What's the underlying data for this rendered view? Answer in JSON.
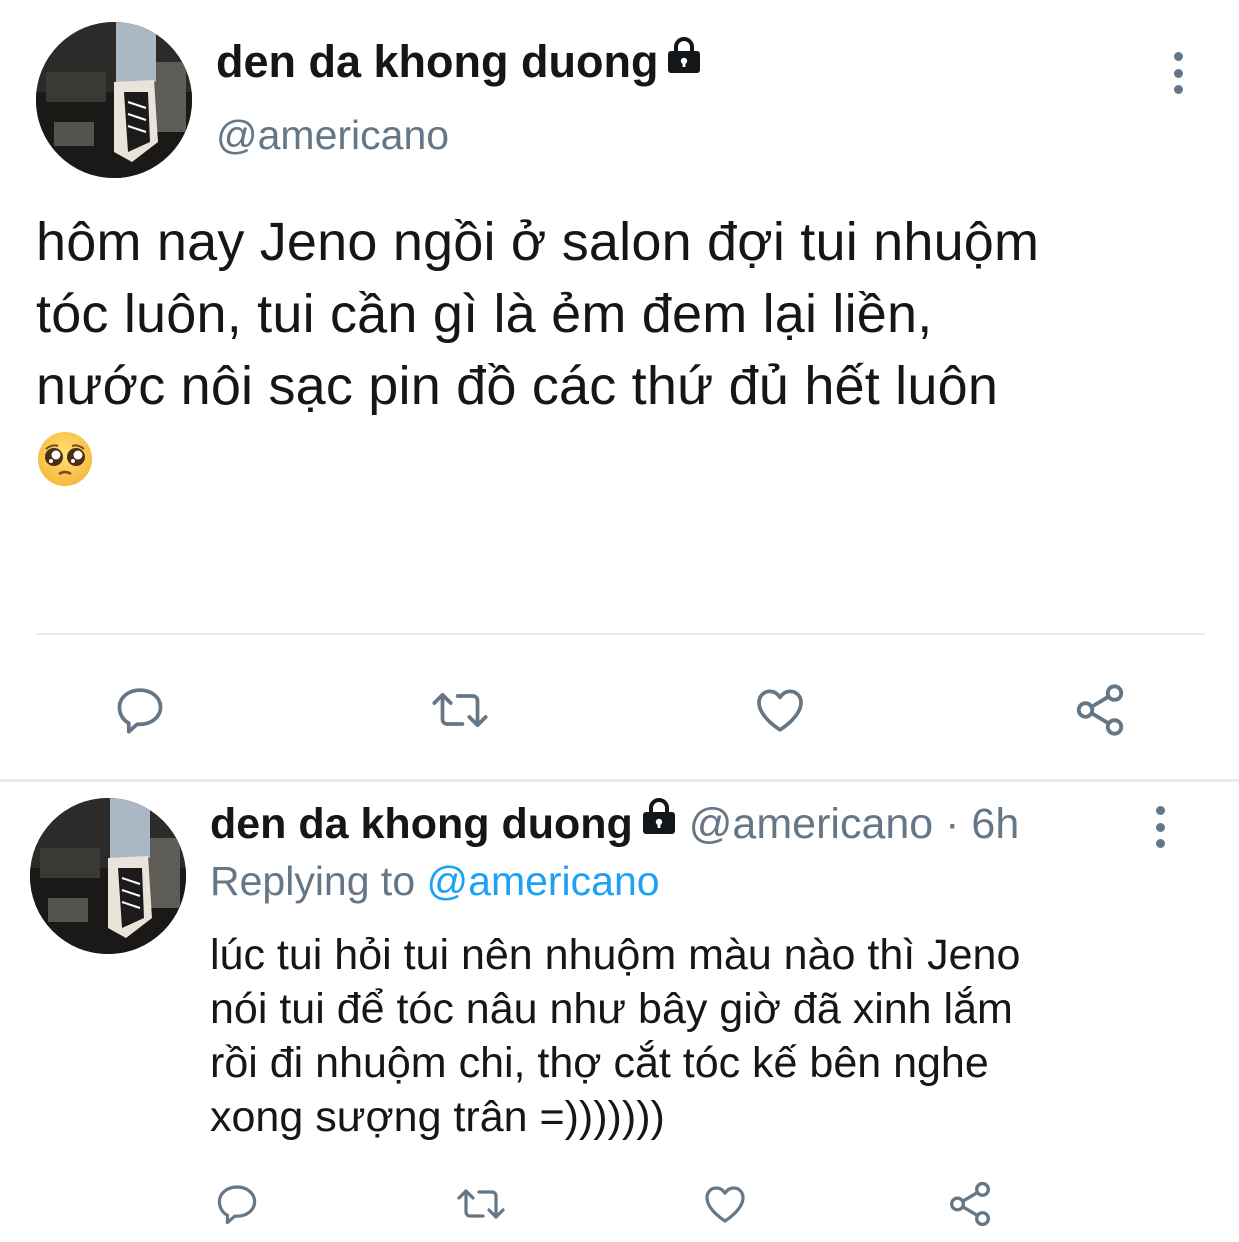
{
  "main_tweet": {
    "author_name": "den da khong duong",
    "handle": "@americano",
    "text_lines": [
      "hôm nay Jeno ngồi ở salon đợi tui nhuộm",
      "tóc luôn, tui cần gì là ẻm đem lại liền,",
      "nước nôi sạc pin đồ các thứ đủ hết luôn"
    ],
    "emoji": "pleading-face",
    "protected_icon": "lock-icon",
    "actions": [
      "reply-icon",
      "retweet-icon",
      "like-icon",
      "share-icon"
    ]
  },
  "reply_tweet": {
    "author_name": "den da khong duong",
    "handle_time": "@americano · 6h",
    "replying_prefix": "Replying to ",
    "replying_to": "@americano",
    "text_lines": [
      "lúc tui hỏi tui nên nhuộm màu nào thì Jeno",
      "nói tui để tóc nâu như bây giờ đã xinh lắm",
      "rồi đi nhuộm chi, thợ cắt tóc kế bên nghe",
      "xong sượng trân =)))))))"
    ],
    "actions": [
      "reply-icon",
      "retweet-icon",
      "like-icon",
      "share-icon"
    ]
  },
  "colors": {
    "text": "#14171a",
    "secondary": "#657786",
    "accent": "#1da1f2",
    "divider": "#e6ecf0"
  }
}
